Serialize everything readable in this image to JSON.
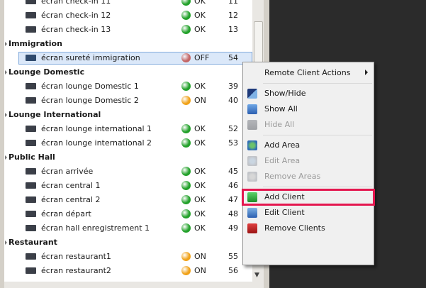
{
  "colors": {
    "ok": "#22a12a",
    "on": "#f0a21a",
    "off": "#c46666",
    "highlight": "#e4174f"
  },
  "rows": [
    {
      "type": "client",
      "name": "écran check-in 11",
      "status": "ok",
      "status_label": "OK",
      "id": "11"
    },
    {
      "type": "client",
      "name": "écran check-in 12",
      "status": "ok",
      "status_label": "OK",
      "id": "12"
    },
    {
      "type": "client",
      "name": "écran check-in 13",
      "status": "ok",
      "status_label": "OK",
      "id": "13"
    },
    {
      "type": "group",
      "name": "Immigration"
    },
    {
      "type": "client",
      "name": "écran sureté immigration",
      "status": "off",
      "status_label": "OFF",
      "id": "54",
      "selected": true
    },
    {
      "type": "group",
      "name": "Lounge Domestic"
    },
    {
      "type": "client",
      "name": "écran lounge Domestic 1",
      "status": "ok",
      "status_label": "OK",
      "id": "39"
    },
    {
      "type": "client",
      "name": "écran lounge Domestic 2",
      "status": "on",
      "status_label": "ON",
      "id": "40"
    },
    {
      "type": "group",
      "name": "Lounge International"
    },
    {
      "type": "client",
      "name": "écran lounge international 1",
      "status": "ok",
      "status_label": "OK",
      "id": "52"
    },
    {
      "type": "client",
      "name": "écran lounge international 2",
      "status": "ok",
      "status_label": "OK",
      "id": "53"
    },
    {
      "type": "group",
      "name": "Public Hall"
    },
    {
      "type": "client",
      "name": "écran arrivée",
      "status": "ok",
      "status_label": "OK",
      "id": "45"
    },
    {
      "type": "client",
      "name": "écran central 1",
      "status": "ok",
      "status_label": "OK",
      "id": "46"
    },
    {
      "type": "client",
      "name": "écran central 2",
      "status": "ok",
      "status_label": "OK",
      "id": "47"
    },
    {
      "type": "client",
      "name": "écran départ",
      "status": "ok",
      "status_label": "OK",
      "id": "48"
    },
    {
      "type": "client",
      "name": "écran hall enregistrement 1",
      "status": "ok",
      "status_label": "OK",
      "id": "49"
    },
    {
      "type": "group",
      "name": "Restaurant"
    },
    {
      "type": "client",
      "name": "écran restaurant1",
      "status": "on",
      "status_label": "ON",
      "id": "55"
    },
    {
      "type": "client",
      "name": "écran restaurant2",
      "status": "on",
      "status_label": "ON",
      "id": "56"
    }
  ],
  "context_menu": {
    "items": [
      {
        "kind": "item",
        "label": "Remote Client Actions",
        "icon": "none",
        "enabled": true,
        "submenu": true
      },
      {
        "kind": "separator"
      },
      {
        "kind": "item",
        "label": "Show/Hide",
        "icon": "show-hide-icon",
        "enabled": true
      },
      {
        "kind": "item",
        "label": "Show All",
        "icon": "show-all-icon",
        "enabled": true
      },
      {
        "kind": "item",
        "label": "Hide All",
        "icon": "hide-all-icon",
        "enabled": false
      },
      {
        "kind": "separator"
      },
      {
        "kind": "item",
        "label": "Add Area",
        "icon": "add-area-icon",
        "enabled": true
      },
      {
        "kind": "item",
        "label": "Edit Area",
        "icon": "edit-area-icon",
        "enabled": false
      },
      {
        "kind": "item",
        "label": "Remove Areas",
        "icon": "remove-areas-icon",
        "enabled": false
      },
      {
        "kind": "separator"
      },
      {
        "kind": "item",
        "label": "Add Client",
        "icon": "add-client-icon",
        "enabled": true,
        "highlighted": true
      },
      {
        "kind": "item",
        "label": "Edit Client",
        "icon": "edit-client-icon",
        "enabled": true
      },
      {
        "kind": "item",
        "label": "Remove Clients",
        "icon": "remove-clients-icon",
        "enabled": true
      }
    ]
  }
}
